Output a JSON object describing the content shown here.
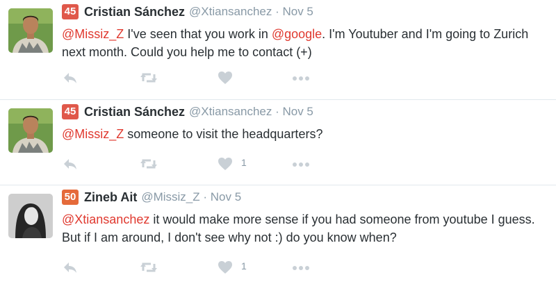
{
  "tweets": [
    {
      "badge": "45",
      "name": "Cristian Sánchez",
      "meta": "@Xtiansanchez · Nov 5",
      "text_parts": [
        {
          "mention": "@Missiz_Z"
        },
        {
          "text": " I've seen that you work in "
        },
        {
          "mention": "@google"
        },
        {
          "text": ". I'm Youtuber and I'm going to Zurich next month. Could you help me to contact (+)"
        }
      ],
      "like_count": ""
    },
    {
      "badge": "45",
      "name": "Cristian Sánchez",
      "meta": "@Xtiansanchez · Nov 5",
      "text_parts": [
        {
          "mention": "@Missiz_Z"
        },
        {
          "text": " someone to visit the headquarters?"
        }
      ],
      "like_count": "1"
    },
    {
      "badge": "50",
      "name": "Zineb Ait",
      "meta": "@Missiz_Z · Nov 5",
      "text_parts": [
        {
          "mention": "@Xtiansanchez"
        },
        {
          "text": " it would make more sense if you had someone from youtube I guess. But if I am around, I don't see why not :) do you know when?"
        }
      ],
      "like_count": "1"
    }
  ],
  "icons": {
    "reply": "reply-icon",
    "retweet": "retweet-icon",
    "like": "heart-icon",
    "more": "more-icon"
  },
  "colors": {
    "mention": "#e0392f",
    "badge_red": "#e0584a",
    "badge_orange": "#e56a3a",
    "icon_gray": "#c9d0d6",
    "meta_gray": "#8899a6"
  }
}
